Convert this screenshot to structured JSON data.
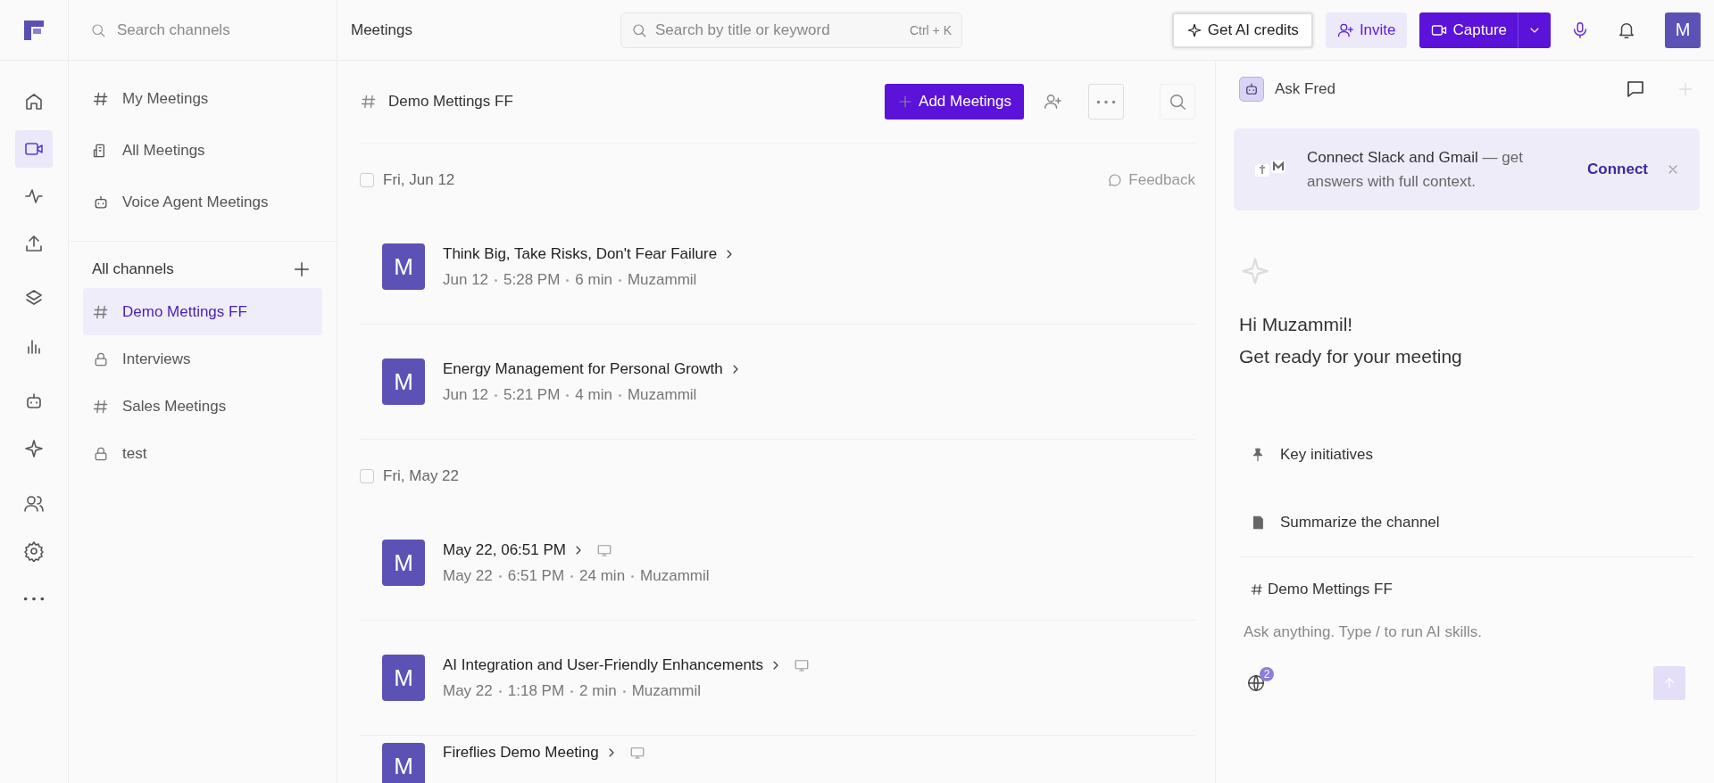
{
  "topbar": {
    "channel_search": {
      "placeholder": "Search channels"
    },
    "page_title": "Meetings",
    "search": {
      "placeholder": "Search by title or keyword",
      "shortcut": "Ctrl + K"
    },
    "credits_button": "Get AI credits",
    "invite_button": "Invite",
    "capture_button": "Capture",
    "avatar": "M"
  },
  "rail": {
    "groups": [
      {
        "items": [
          {
            "kind": "home",
            "selected": false
          },
          {
            "kind": "video",
            "selected": true
          },
          {
            "kind": "activity",
            "selected": false
          },
          {
            "kind": "upload",
            "selected": false
          }
        ]
      },
      {
        "items": [
          {
            "kind": "layers",
            "selected": false
          },
          {
            "kind": "chart",
            "selected": false
          }
        ]
      },
      {
        "items": [
          {
            "kind": "bot",
            "selected": false
          },
          {
            "kind": "sparkle",
            "selected": false
          }
        ]
      },
      {
        "items": [
          {
            "kind": "users",
            "selected": false
          },
          {
            "kind": "settings",
            "selected": false
          },
          {
            "kind": "more",
            "selected": false
          }
        ]
      }
    ]
  },
  "sidebar": {
    "views": [
      {
        "kind": "hash",
        "label": "My Meetings"
      },
      {
        "kind": "building",
        "label": "All Meetings"
      },
      {
        "kind": "bot",
        "label": "Voice Agent Meetings"
      }
    ],
    "channels_header": "All channels",
    "channels": [
      {
        "kind": "hash",
        "label": "Demo Mettings FF",
        "selected": true
      },
      {
        "kind": "lock",
        "label": "Interviews",
        "selected": false
      },
      {
        "kind": "hash",
        "label": "Sales Meetings",
        "selected": false
      },
      {
        "kind": "lock",
        "label": "test",
        "selected": false
      }
    ]
  },
  "main": {
    "channel_title": "Demo Mettings FF",
    "add_button": "Add Meetings",
    "groups": [
      {
        "date": "Fri, Jun 12",
        "checked": false,
        "feedback": "Feedback",
        "meetings": [
          {
            "avatar": "M",
            "title": "Think Big, Take Risks, Don't Fear Failure",
            "screen_icon": false,
            "date": "Jun 12",
            "time": "5:28 PM",
            "duration": "6 min",
            "owner": "Muzammil"
          },
          {
            "avatar": "M",
            "title": "Energy Management for Personal Growth",
            "screen_icon": false,
            "date": "Jun 12",
            "time": "5:21 PM",
            "duration": "4 min",
            "owner": "Muzammil"
          }
        ]
      },
      {
        "date": "Fri, May 22",
        "checked": false,
        "meetings": [
          {
            "avatar": "M",
            "title": "May 22, 06:51 PM",
            "screen_icon": true,
            "date": "May 22",
            "time": "6:51 PM",
            "duration": "24 min",
            "owner": "Muzammil"
          },
          {
            "avatar": "M",
            "title": "AI Integration and User-Friendly Enhancements",
            "screen_icon": true,
            "date": "May 22",
            "time": "1:18 PM",
            "duration": "2 min",
            "owner": "Muzammil"
          },
          {
            "avatar": "M",
            "title": "Fireflies Demo Meeting",
            "screen_icon": true
          }
        ]
      }
    ]
  },
  "assistant": {
    "title": "Ask Fred",
    "banner": {
      "text": "**Connect Slack and Gmail** — get answers with full context.",
      "action": "Connect"
    },
    "greeting": "Hi Muzammil!",
    "subtitle": "Get ready for your meeting",
    "suggestions": [
      {
        "kind": "pin",
        "label": "Key initiatives"
      },
      {
        "kind": "doc",
        "label": "Summarize the channel"
      }
    ],
    "context_channel": "Demo Mettings FF",
    "input": {
      "placeholder": "Ask anything. Type / to run AI skills."
    },
    "sources_badge": "2"
  }
}
